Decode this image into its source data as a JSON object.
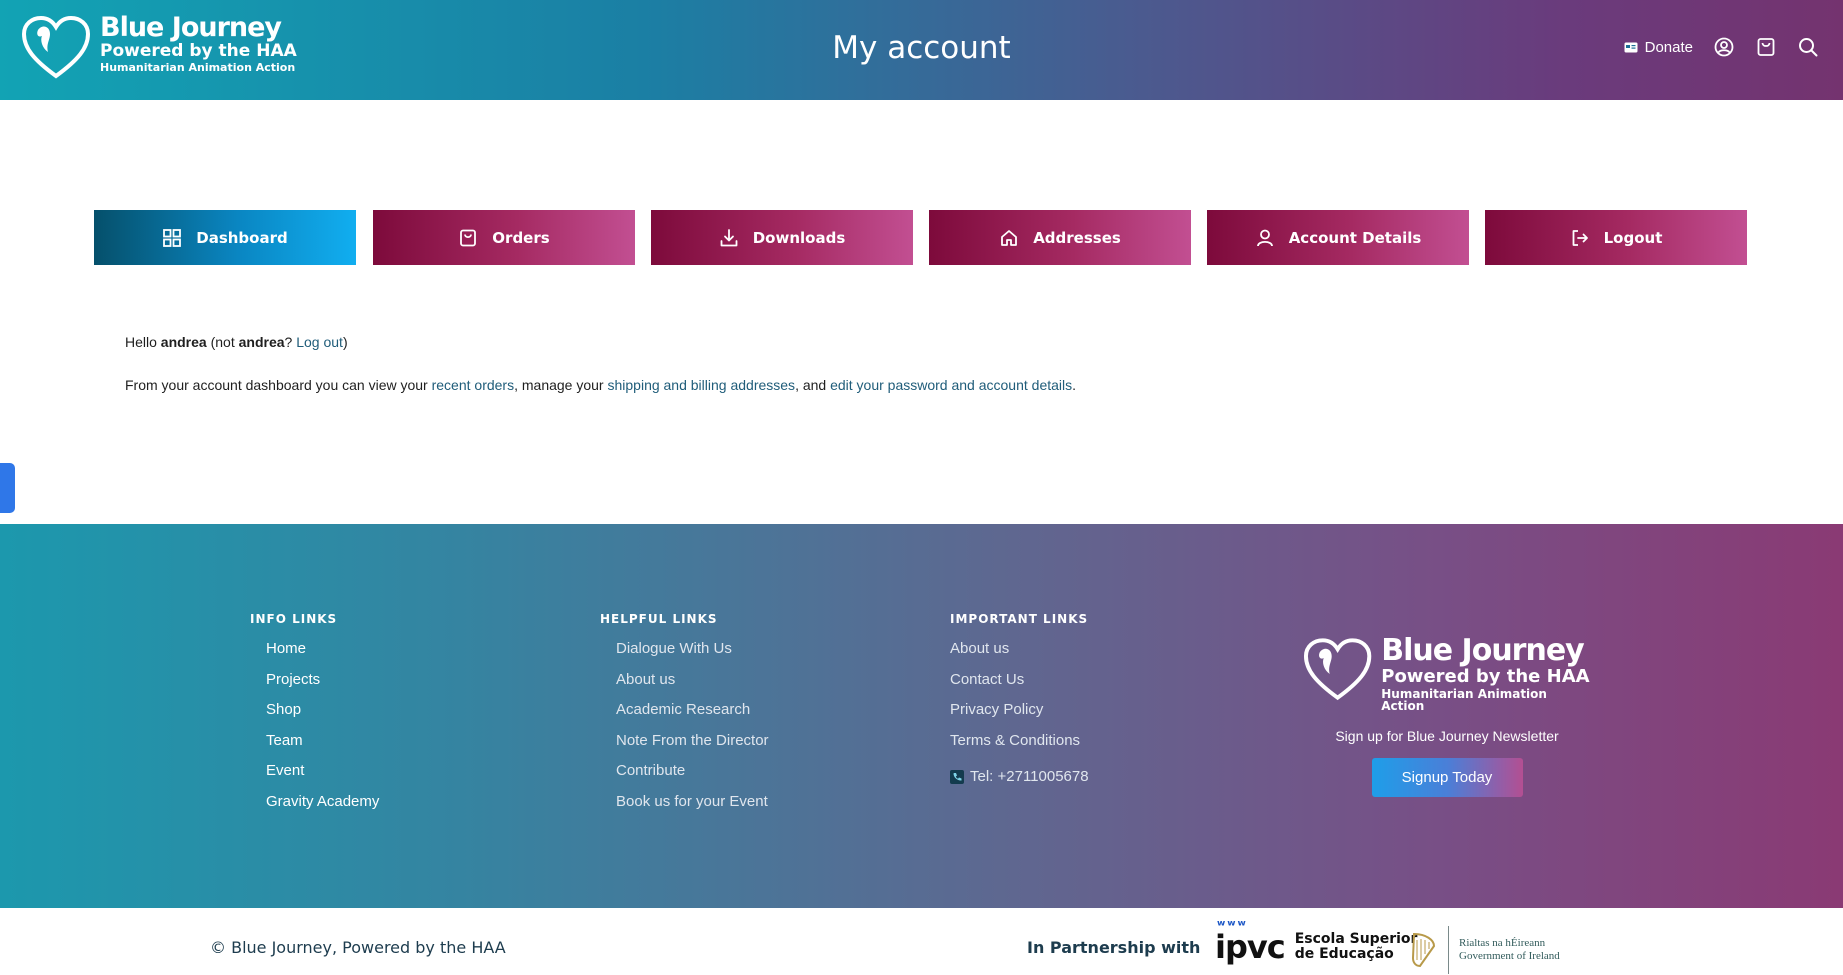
{
  "header": {
    "logo": {
      "title": "Blue Journey",
      "subtitle": "Powered by the HAA",
      "tagline": "Humanitarian Animation Action"
    },
    "page_title": "My account",
    "actions": {
      "donate_label": "Donate",
      "icons": [
        "donate-card-icon",
        "user-account-icon",
        "cart-icon",
        "search-icon"
      ]
    }
  },
  "account_nav": {
    "items": [
      {
        "label": "Dashboard",
        "icon": "dashboard-grid-icon",
        "active": true
      },
      {
        "label": "Orders",
        "icon": "shopping-bag-icon"
      },
      {
        "label": "Downloads",
        "icon": "download-icon"
      },
      {
        "label": "Addresses",
        "icon": "home-icon"
      },
      {
        "label": "Account Details",
        "icon": "user-icon"
      },
      {
        "label": "Logout",
        "icon": "logout-icon"
      }
    ]
  },
  "dashboard": {
    "greeting": {
      "hello": "Hello",
      "username": "andrea",
      "not_prefix": "(not",
      "not_user": "andrea",
      "question": "?",
      "logout_link": "Log out",
      "close": ")"
    },
    "intro": {
      "part1": "From your account dashboard you can view your",
      "link_orders": "recent orders",
      "part2": ", manage your",
      "link_addresses": "shipping and billing addresses",
      "part3": ", and",
      "link_account": "edit your password and account details",
      "part4": "."
    }
  },
  "footer": {
    "info": {
      "heading": "INFO LINKS",
      "links": [
        "Home",
        "Projects",
        "Shop",
        "Team",
        "Event",
        "Gravity Academy"
      ]
    },
    "helpful": {
      "heading": "HELPFUL LINKS",
      "links": [
        "Dialogue With Us",
        "About us",
        "Academic Research",
        "Note From the Director",
        "Contribute",
        "Book us for your Event"
      ]
    },
    "important": {
      "heading": "IMPORTANT LINKS",
      "links": [
        "About us",
        "Contact Us",
        "Privacy Policy",
        "Terms & Conditions"
      ],
      "phone": "Tel: +2711005678"
    },
    "brand": {
      "title": "Blue Journey",
      "subtitle": "Powered by the HAA",
      "tagline": "Humanitarian Animation Action",
      "newsletter": "Sign up for Blue Journey Newsletter",
      "signup_label": "Signup Today"
    }
  },
  "bottom": {
    "copyright": "© Blue Journey, Powered by the HAA",
    "partner_label": "In Partnership with",
    "ipvc": {
      "mark": "ipvc",
      "line1": "Escola Superior",
      "line2": "de Educação"
    },
    "gov": {
      "line1": "Rialtas na hÉireann",
      "line2": "Government of Ireland"
    }
  },
  "colors": {
    "nav_active": "#0a86c2",
    "nav_inactive": "#a52a62",
    "link": "#205d7a",
    "side_tab": "#2f77e8"
  }
}
